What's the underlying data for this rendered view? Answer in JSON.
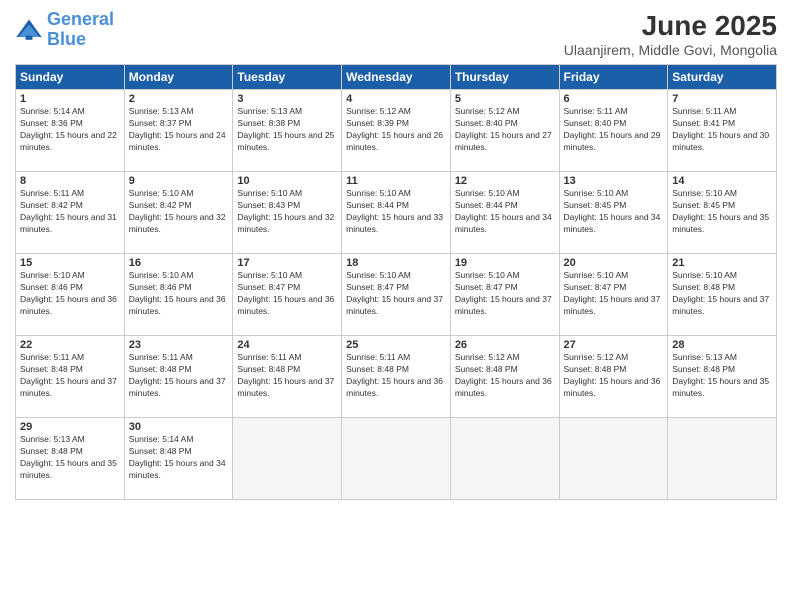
{
  "header": {
    "logo_line1": "General",
    "logo_line2": "Blue",
    "month": "June 2025",
    "location": "Ulaanjirem, Middle Govi, Mongolia"
  },
  "weekdays": [
    "Sunday",
    "Monday",
    "Tuesday",
    "Wednesday",
    "Thursday",
    "Friday",
    "Saturday"
  ],
  "weeks": [
    [
      {
        "day": "1",
        "sunrise": "5:14 AM",
        "sunset": "8:36 PM",
        "daylight": "15 hours and 22 minutes."
      },
      {
        "day": "2",
        "sunrise": "5:13 AM",
        "sunset": "8:37 PM",
        "daylight": "15 hours and 24 minutes."
      },
      {
        "day": "3",
        "sunrise": "5:13 AM",
        "sunset": "8:38 PM",
        "daylight": "15 hours and 25 minutes."
      },
      {
        "day": "4",
        "sunrise": "5:12 AM",
        "sunset": "8:39 PM",
        "daylight": "15 hours and 26 minutes."
      },
      {
        "day": "5",
        "sunrise": "5:12 AM",
        "sunset": "8:40 PM",
        "daylight": "15 hours and 27 minutes."
      },
      {
        "day": "6",
        "sunrise": "5:11 AM",
        "sunset": "8:40 PM",
        "daylight": "15 hours and 29 minutes."
      },
      {
        "day": "7",
        "sunrise": "5:11 AM",
        "sunset": "8:41 PM",
        "daylight": "15 hours and 30 minutes."
      }
    ],
    [
      {
        "day": "8",
        "sunrise": "5:11 AM",
        "sunset": "8:42 PM",
        "daylight": "15 hours and 31 minutes."
      },
      {
        "day": "9",
        "sunrise": "5:10 AM",
        "sunset": "8:42 PM",
        "daylight": "15 hours and 32 minutes."
      },
      {
        "day": "10",
        "sunrise": "5:10 AM",
        "sunset": "8:43 PM",
        "daylight": "15 hours and 32 minutes."
      },
      {
        "day": "11",
        "sunrise": "5:10 AM",
        "sunset": "8:44 PM",
        "daylight": "15 hours and 33 minutes."
      },
      {
        "day": "12",
        "sunrise": "5:10 AM",
        "sunset": "8:44 PM",
        "daylight": "15 hours and 34 minutes."
      },
      {
        "day": "13",
        "sunrise": "5:10 AM",
        "sunset": "8:45 PM",
        "daylight": "15 hours and 34 minutes."
      },
      {
        "day": "14",
        "sunrise": "5:10 AM",
        "sunset": "8:45 PM",
        "daylight": "15 hours and 35 minutes."
      }
    ],
    [
      {
        "day": "15",
        "sunrise": "5:10 AM",
        "sunset": "8:46 PM",
        "daylight": "15 hours and 36 minutes."
      },
      {
        "day": "16",
        "sunrise": "5:10 AM",
        "sunset": "8:46 PM",
        "daylight": "15 hours and 36 minutes."
      },
      {
        "day": "17",
        "sunrise": "5:10 AM",
        "sunset": "8:47 PM",
        "daylight": "15 hours and 36 minutes."
      },
      {
        "day": "18",
        "sunrise": "5:10 AM",
        "sunset": "8:47 PM",
        "daylight": "15 hours and 37 minutes."
      },
      {
        "day": "19",
        "sunrise": "5:10 AM",
        "sunset": "8:47 PM",
        "daylight": "15 hours and 37 minutes."
      },
      {
        "day": "20",
        "sunrise": "5:10 AM",
        "sunset": "8:47 PM",
        "daylight": "15 hours and 37 minutes."
      },
      {
        "day": "21",
        "sunrise": "5:10 AM",
        "sunset": "8:48 PM",
        "daylight": "15 hours and 37 minutes."
      }
    ],
    [
      {
        "day": "22",
        "sunrise": "5:11 AM",
        "sunset": "8:48 PM",
        "daylight": "15 hours and 37 minutes."
      },
      {
        "day": "23",
        "sunrise": "5:11 AM",
        "sunset": "8:48 PM",
        "daylight": "15 hours and 37 minutes."
      },
      {
        "day": "24",
        "sunrise": "5:11 AM",
        "sunset": "8:48 PM",
        "daylight": "15 hours and 37 minutes."
      },
      {
        "day": "25",
        "sunrise": "5:11 AM",
        "sunset": "8:48 PM",
        "daylight": "15 hours and 36 minutes."
      },
      {
        "day": "26",
        "sunrise": "5:12 AM",
        "sunset": "8:48 PM",
        "daylight": "15 hours and 36 minutes."
      },
      {
        "day": "27",
        "sunrise": "5:12 AM",
        "sunset": "8:48 PM",
        "daylight": "15 hours and 36 minutes."
      },
      {
        "day": "28",
        "sunrise": "5:13 AM",
        "sunset": "8:48 PM",
        "daylight": "15 hours and 35 minutes."
      }
    ],
    [
      {
        "day": "29",
        "sunrise": "5:13 AM",
        "sunset": "8:48 PM",
        "daylight": "15 hours and 35 minutes."
      },
      {
        "day": "30",
        "sunrise": "5:14 AM",
        "sunset": "8:48 PM",
        "daylight": "15 hours and 34 minutes."
      },
      null,
      null,
      null,
      null,
      null
    ]
  ]
}
